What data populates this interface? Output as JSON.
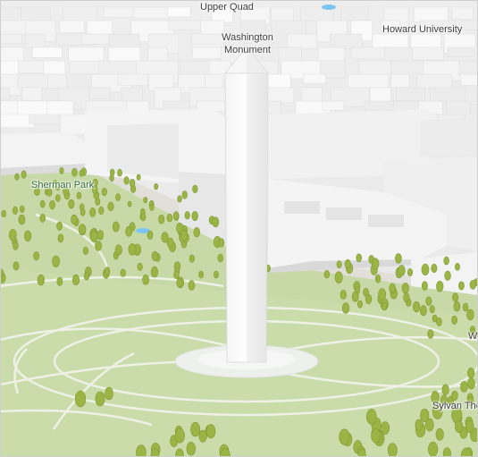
{
  "map": {
    "type": "3d-city-map",
    "colors": {
      "park": "#c7d9a7",
      "park_light": "#d3e2b7",
      "building": "#f3f3f3",
      "building_side": "#dcdcdc",
      "path": "#eef1e6",
      "tree": "#9bb446",
      "tree_shadow": "#7f9a35",
      "water": "#7ec4f2",
      "road": "#e2ded8"
    },
    "labels": {
      "upper_quad": "Upper Quad",
      "howard_university": "Howard University",
      "washington_monument": "Washington Monument",
      "sherman_park": "Sherman Park",
      "sylvan_theater": "Sylvan The",
      "edge_w": "W"
    }
  }
}
